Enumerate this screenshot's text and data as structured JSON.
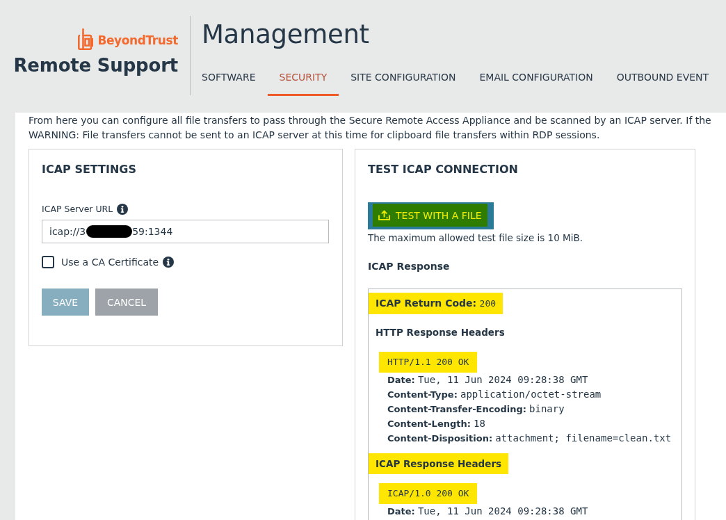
{
  "brand": {
    "company": "BeyondTrust",
    "product": "Remote Support"
  },
  "header": {
    "title": "Management"
  },
  "tabs": [
    {
      "label": "SOFTWARE",
      "selected": false
    },
    {
      "label": "SECURITY",
      "selected": true
    },
    {
      "label": "SITE CONFIGURATION",
      "selected": false
    },
    {
      "label": "EMAIL CONFIGURATION",
      "selected": false
    },
    {
      "label": "OUTBOUND EVENT",
      "selected": false
    }
  ],
  "intro": [
    "From here you can configure all file transfers to pass through the Secure Remote Access Appliance and be scanned by an ICAP server. If the",
    "WARNING: File transfers cannot be sent to an ICAP server at this time for clipboard file transfers within RDP sessions."
  ],
  "icap_settings": {
    "title": "ICAP SETTINGS",
    "url_label": "ICAP Server URL",
    "url_field": {
      "value_start": "icap://3",
      "value_end": "59:1344",
      "redacted": true
    },
    "ca_certificate": {
      "label": "Use a CA Certificate",
      "checked": false
    },
    "buttons": [
      {
        "label": "SAVE",
        "kind": "primary",
        "disabled": true
      },
      {
        "label": "CANCEL",
        "kind": "secondary",
        "disabled": true
      }
    ]
  },
  "test_connection": {
    "title": "TEST ICAP CONNECTION",
    "test_button": {
      "label": "TEST WITH A FILE",
      "highlighted": true
    },
    "note": "The maximum allowed test file size is 10 MiB.",
    "response_title": "ICAP Response",
    "response": {
      "return_code": {
        "label": "ICAP Return Code:",
        "value": "200",
        "highlighted": true
      },
      "sections": [
        {
          "title": "HTTP Response Headers",
          "title_highlighted": false,
          "status_line": "HTTP/1.1 200 OK",
          "status_highlighted": true,
          "headers": [
            {
              "name": "Date:",
              "value": "Tue, 11 Jun 2024 09:28:38 GMT"
            },
            {
              "name": "Content-Type:",
              "value": "application/octet-stream"
            },
            {
              "name": "Content-Transfer-Encoding:",
              "value": "binary"
            },
            {
              "name": "Content-Length:",
              "value": "18"
            },
            {
              "name": "Content-Disposition:",
              "value": "attachment; filename=clean.txt"
            }
          ]
        },
        {
          "title": "ICAP Response Headers",
          "title_highlighted": true,
          "status_line": "ICAP/1.0 200 OK",
          "status_highlighted": true,
          "headers": [
            {
              "name": "Date:",
              "value": "Tue, 11 Jun 2024 09:28:38 GMT"
            }
          ]
        }
      ]
    }
  }
}
